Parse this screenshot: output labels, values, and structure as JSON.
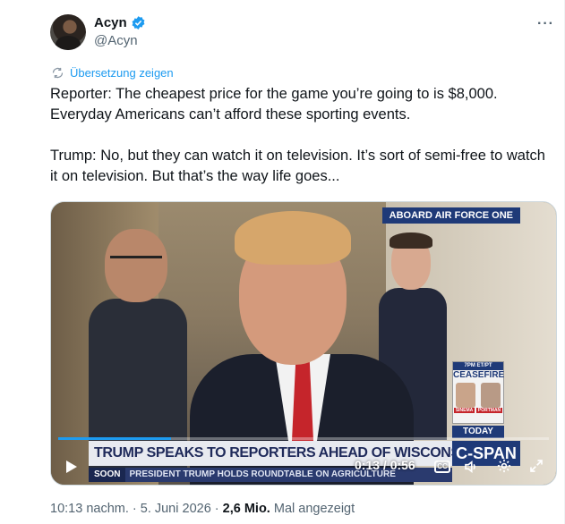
{
  "author": {
    "display_name": "Acyn",
    "handle": "@Acyn",
    "verified": true,
    "verified_color": "#1d9bf0"
  },
  "menu": {
    "more_label": "···"
  },
  "translate": {
    "label": "Übersetzung zeigen",
    "icon": "translate-icon"
  },
  "tweet": {
    "paragraphs": [
      "Reporter: The cheapest price for the game you’re going to is $8,000. Everyday Americans can’t afford these sporting events.",
      "Trump: No, but they can watch it on television. It’s sort of semi-free to watch it on television. But that’s the way life goes..."
    ]
  },
  "video": {
    "corner_banner": "ABOARD AIR FORCE ONE",
    "ceasefire_panel": {
      "time": "7PM ET/PT",
      "title": "CEASEFIRE",
      "names": [
        "SINEMA",
        "PORTMAN"
      ]
    },
    "today_label": "TODAY",
    "headline": "TRUMP SPEAKS TO REPORTERS AHEAD OF WISCONSIN EVENT",
    "network": "C-SPAN",
    "ticker_label": "SOON",
    "ticker_text": "PRESIDENT TRUMP HOLDS ROUNDTABLE ON AGRICULTURE",
    "time_display": "0:13 / 0:56",
    "progress_fraction": 0.23,
    "cc_label": "CC"
  },
  "meta": {
    "timestamp": "10:13 nachm. · 5. Juni 2026 · ",
    "views": "2,6 Mio.",
    "views_suffix": " Mal angezeigt"
  },
  "colors": {
    "accent": "#1d9bf0",
    "text_primary": "#0f1419",
    "text_secondary": "#536471"
  }
}
